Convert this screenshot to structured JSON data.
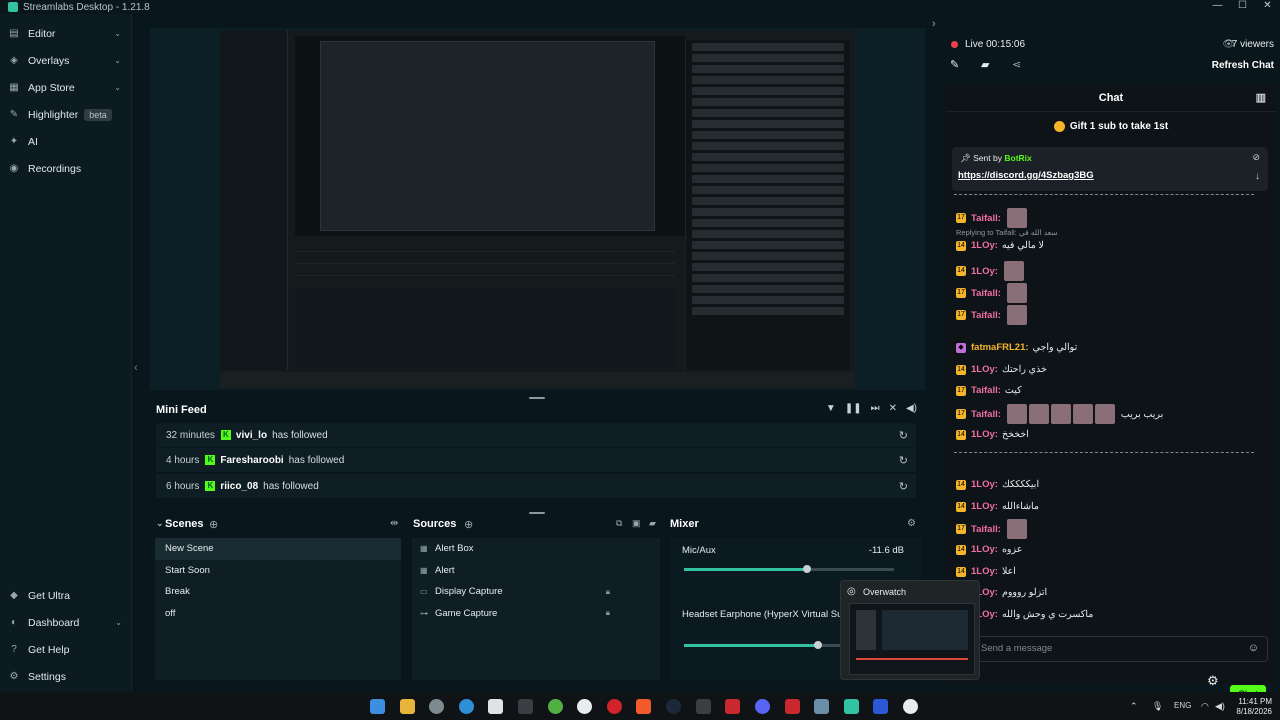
{
  "window": {
    "title": "Streamlabs Desktop - 1.21.8",
    "controls": [
      "—",
      "☐",
      "✕"
    ]
  },
  "sidebar": {
    "items": [
      {
        "label": "Editor",
        "icon": "editor-icon",
        "chevron": true
      },
      {
        "label": "Overlays",
        "icon": "overlays-icon",
        "chevron": true
      },
      {
        "label": "App Store",
        "icon": "app-store-icon",
        "chevron": true
      },
      {
        "label": "Highlighter",
        "icon": "highlighter-icon",
        "badge": "beta"
      },
      {
        "label": "AI",
        "icon": "ai-icon"
      },
      {
        "label": "Recordings",
        "icon": "recordings-icon"
      }
    ],
    "bottom_items": [
      {
        "label": "Get Ultra",
        "icon": "ultra-icon"
      },
      {
        "label": "Dashboard",
        "icon": "dashboard-icon",
        "chevron": true
      },
      {
        "label": "Get Help",
        "icon": "help-icon"
      },
      {
        "label": "Settings",
        "icon": "settings-icon"
      }
    ]
  },
  "mini_feed": {
    "title": "Mini Feed",
    "events": [
      {
        "time": "32 minutes",
        "user": "vivi_lo",
        "action": "has followed"
      },
      {
        "time": "4 hours",
        "user": "Faresharoobi",
        "action": "has followed"
      },
      {
        "time": "6 hours",
        "user": "riico_08",
        "action": "has followed"
      }
    ]
  },
  "scenes": {
    "title": "Scenes",
    "items": [
      "New Scene",
      "Start Soon",
      "Break",
      "off"
    ],
    "active_index": 0
  },
  "sources": {
    "title": "Sources",
    "items": [
      {
        "label": "Alert Box",
        "icon": "alert-box-icon",
        "locked": false
      },
      {
        "label": "Alert",
        "icon": "alert-icon",
        "locked": false
      },
      {
        "label": "Display Capture",
        "icon": "monitor-icon",
        "locked": true
      },
      {
        "label": "Game Capture",
        "icon": "gamepad-icon",
        "locked": true
      }
    ]
  },
  "mixer": {
    "title": "Mixer",
    "channels": [
      {
        "name": "Mic/Aux",
        "db": "-11.6 dB",
        "level": 0.6
      },
      {
        "name": "Headset Earphone (HyperX Virtual Sur",
        "db": "",
        "level": 0.65
      }
    ]
  },
  "stream": {
    "live_label": "Live 00:15:06",
    "viewers": "7 viewers",
    "refresh_label": "Refresh Chat"
  },
  "chat": {
    "title": "Chat",
    "gift_text": "Gift 1 sub to take 1st",
    "pinned": {
      "sent_by_prefix": "Sent by",
      "sender": "BotRix",
      "link": "https://discord.gg/4Szbag3BG"
    },
    "reply_hint": "Replying to Taifall: سعد الله في",
    "messages": [
      {
        "nick": "Taifall:",
        "text": "",
        "color": "#f06fa4",
        "emotes": 1
      },
      {
        "nick": "1LOy:",
        "text": "لا مالي فيه",
        "color": "#f06fa4",
        "emotes": 0
      },
      {
        "nick": "1LOy:",
        "text": "",
        "color": "#f06fa4",
        "emotes": 1
      },
      {
        "nick": "Taifall:",
        "text": "",
        "color": "#f06fa4",
        "emotes": 1
      },
      {
        "nick": "Taifall:",
        "text": "",
        "color": "#f06fa4",
        "emotes": 1
      },
      {
        "nick": "fatmaFRL21:",
        "text": "توالي واجي",
        "color": "#f5b52a",
        "emotes": 0
      },
      {
        "nick": "1LOy:",
        "text": "خذي راحتك",
        "color": "#f06fa4",
        "emotes": 0
      },
      {
        "nick": "Taifall:",
        "text": "كيت",
        "color": "#f06fa4",
        "emotes": 0
      },
      {
        "nick": "Taifall:",
        "text": "بريب بريب",
        "color": "#f06fa4",
        "emotes": 5
      },
      {
        "nick": "1LOy:",
        "text": "اخخخخ",
        "color": "#f06fa4",
        "emotes": 0
      },
      {
        "nick": "1LOy:",
        "text": "ابيككككك",
        "color": "#f06fa4",
        "emotes": 0
      },
      {
        "nick": "1LOy:",
        "text": "ماشاءالله",
        "color": "#f06fa4",
        "emotes": 0
      },
      {
        "nick": "Taifall:",
        "text": "",
        "color": "#f06fa4",
        "emotes": 1
      },
      {
        "nick": "1LOy:",
        "text": "عزوه",
        "color": "#f06fa4",
        "emotes": 0
      },
      {
        "nick": "1LOy:",
        "text": "اعلا",
        "color": "#f06fa4",
        "emotes": 0
      },
      {
        "nick": "1LOy:",
        "text": "اتزلو روووم",
        "color": "#f06fa4",
        "emotes": 0
      },
      {
        "nick": "1LOy:",
        "text": "ماكسرت ي وحش والله",
        "color": "#f06fa4",
        "emotes": 0
      }
    ],
    "input_placeholder": "Send a message",
    "send_label": "Chat"
  },
  "overlay_popup": {
    "title": "Overwatch"
  },
  "taskbar": {
    "language": "ENG",
    "time": "11:41 PM",
    "date": "8/18/2026"
  },
  "colors": {
    "kick_green": "#53fc18",
    "accent_teal": "#31c3a2",
    "live_red": "#f4424d"
  }
}
